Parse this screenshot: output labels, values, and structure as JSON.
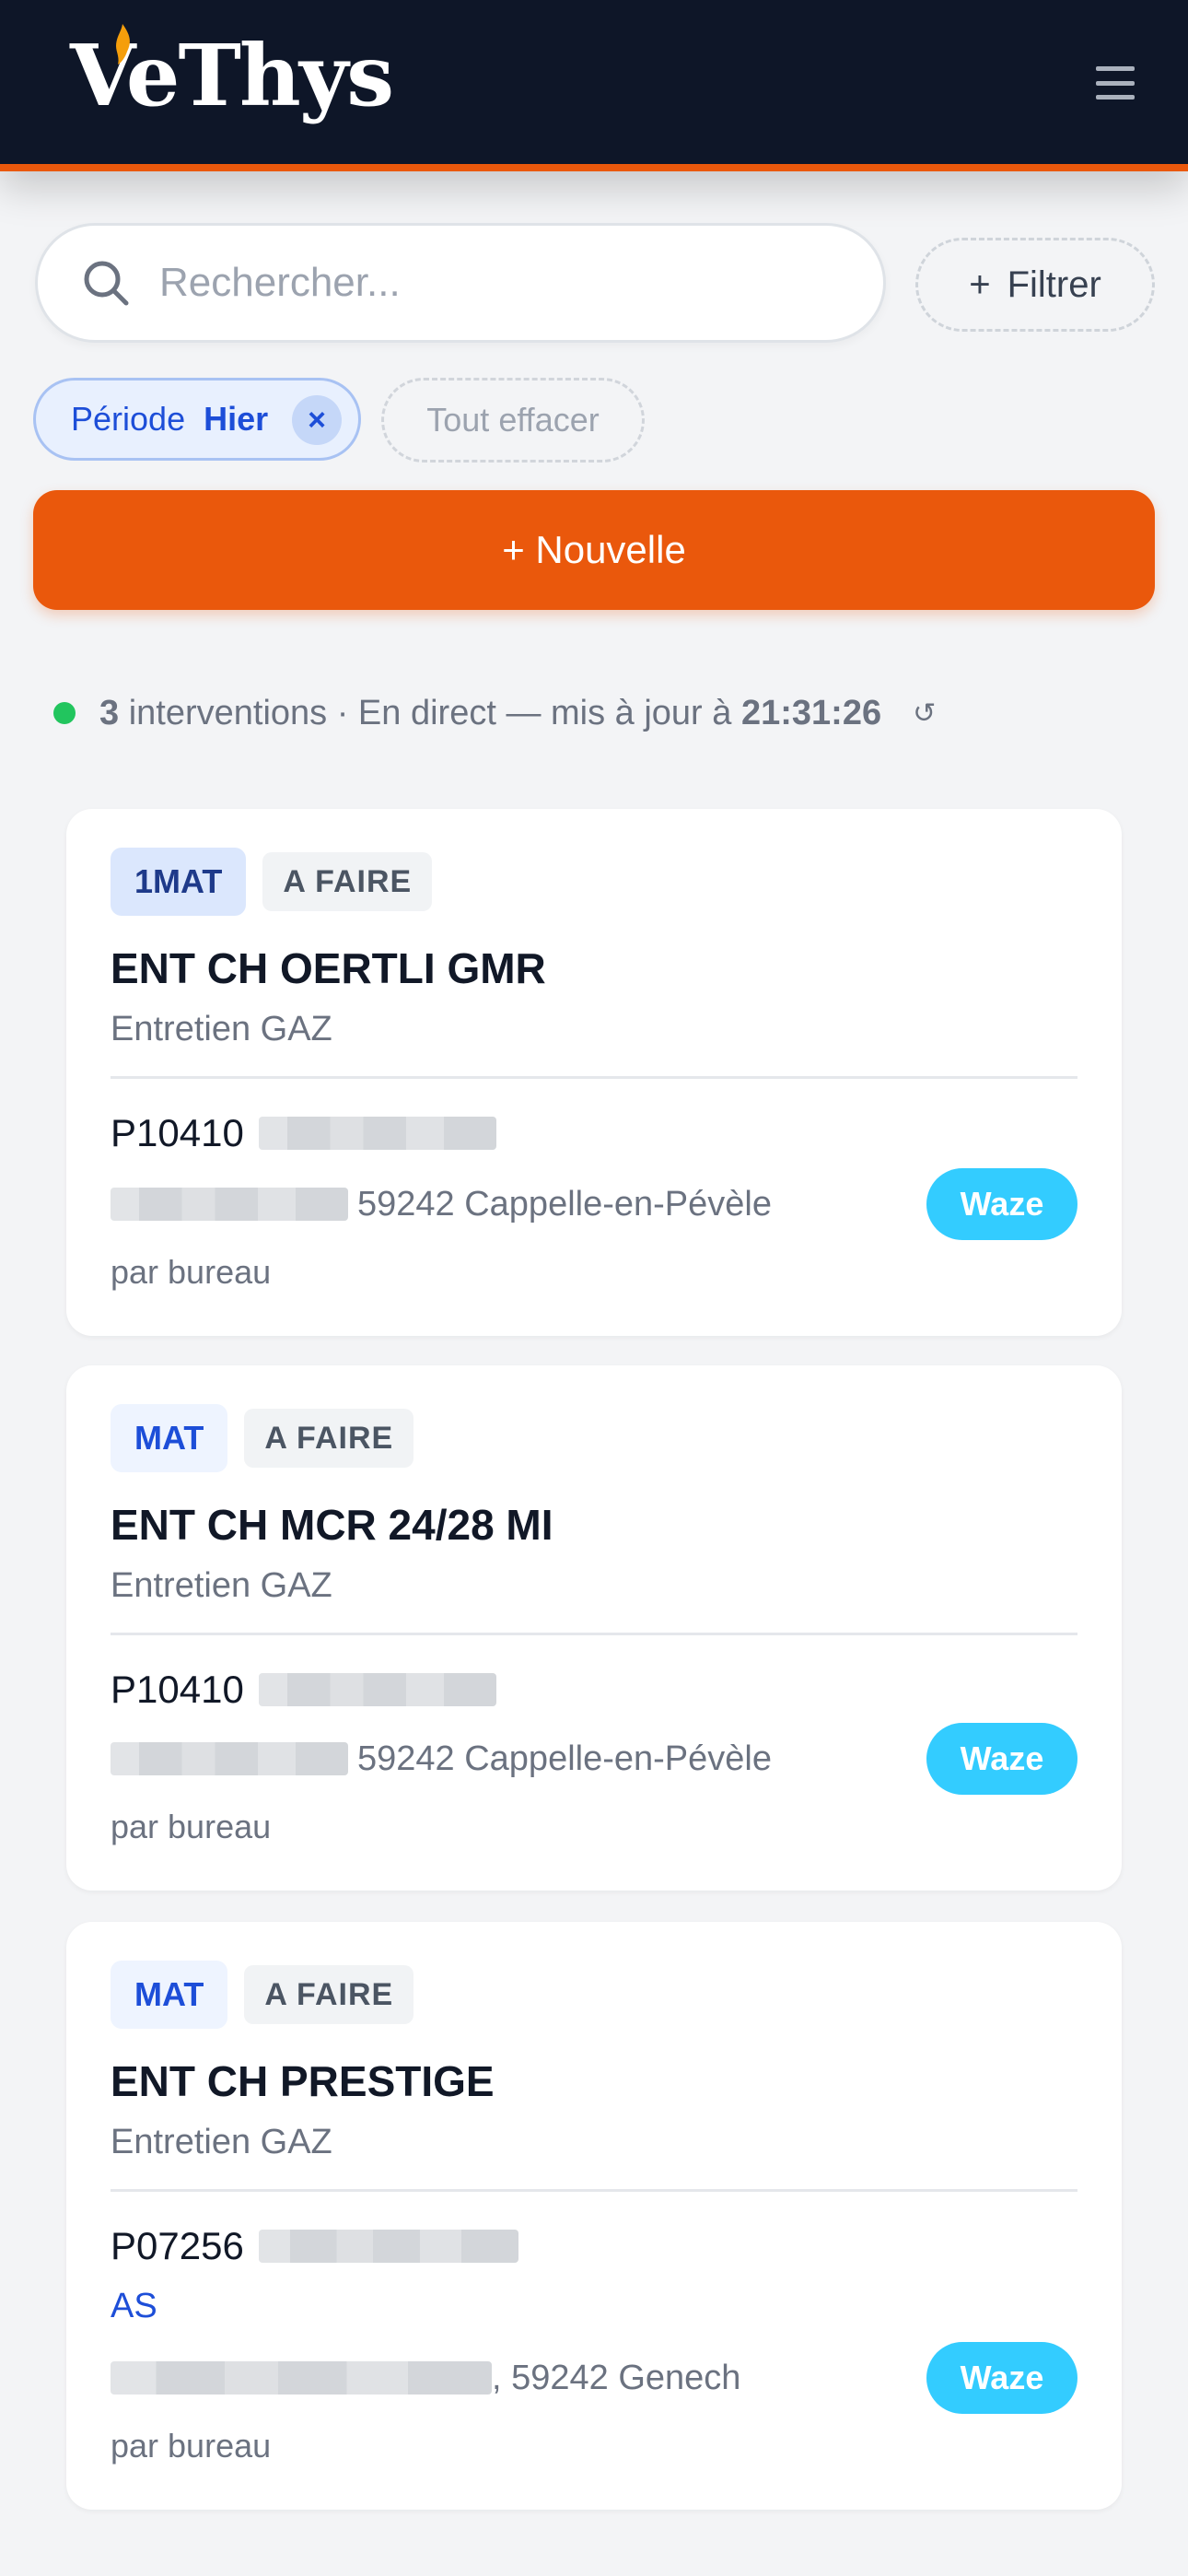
{
  "app": {
    "brand": "VeThys"
  },
  "colors": {
    "header_bg": "#0e1628",
    "accent": "#ea580c",
    "link_blue": "#1d4ed8",
    "waze": "#33ccff",
    "live_dot": "#22c55e"
  },
  "search": {
    "placeholder": "Rechercher...",
    "value": ""
  },
  "filter": {
    "label": "Filtrer"
  },
  "chips": {
    "period_key": "Période",
    "period_value": "Hier",
    "remove_symbol": "×",
    "clear_label": "Tout effacer"
  },
  "new_button": {
    "label": "+ Nouvelle"
  },
  "status": {
    "count": "3",
    "text": "interventions · En direct — mis à jour à",
    "time": "21:31:26",
    "refresh_symbol": "↺"
  },
  "cards": [
    {
      "type": "1MAT",
      "status": "A FAIRE",
      "title": "ENT CH OERTLI GMR",
      "subtitle": "Entretien GAZ",
      "client_ref": "P10410",
      "address_city": "59242 Cappelle-en-Pévèle",
      "by": "par bureau",
      "waze_label": "Waze"
    },
    {
      "type": "MAT",
      "status": "A FAIRE",
      "title": "ENT CH MCR 24/28 MI",
      "subtitle": "Entretien GAZ",
      "client_ref": "P10410",
      "address_city": "59242 Cappelle-en-Pévèle",
      "by": "par bureau",
      "waze_label": "Waze"
    },
    {
      "type": "MAT",
      "status": "A FAIRE",
      "title": "ENT CH PRESTIGE",
      "subtitle": "Entretien GAZ",
      "client_ref": "P07256",
      "extra_tag": "AS",
      "address_city": ", 59242 Genech",
      "by": "par bureau",
      "waze_label": "Waze"
    }
  ]
}
